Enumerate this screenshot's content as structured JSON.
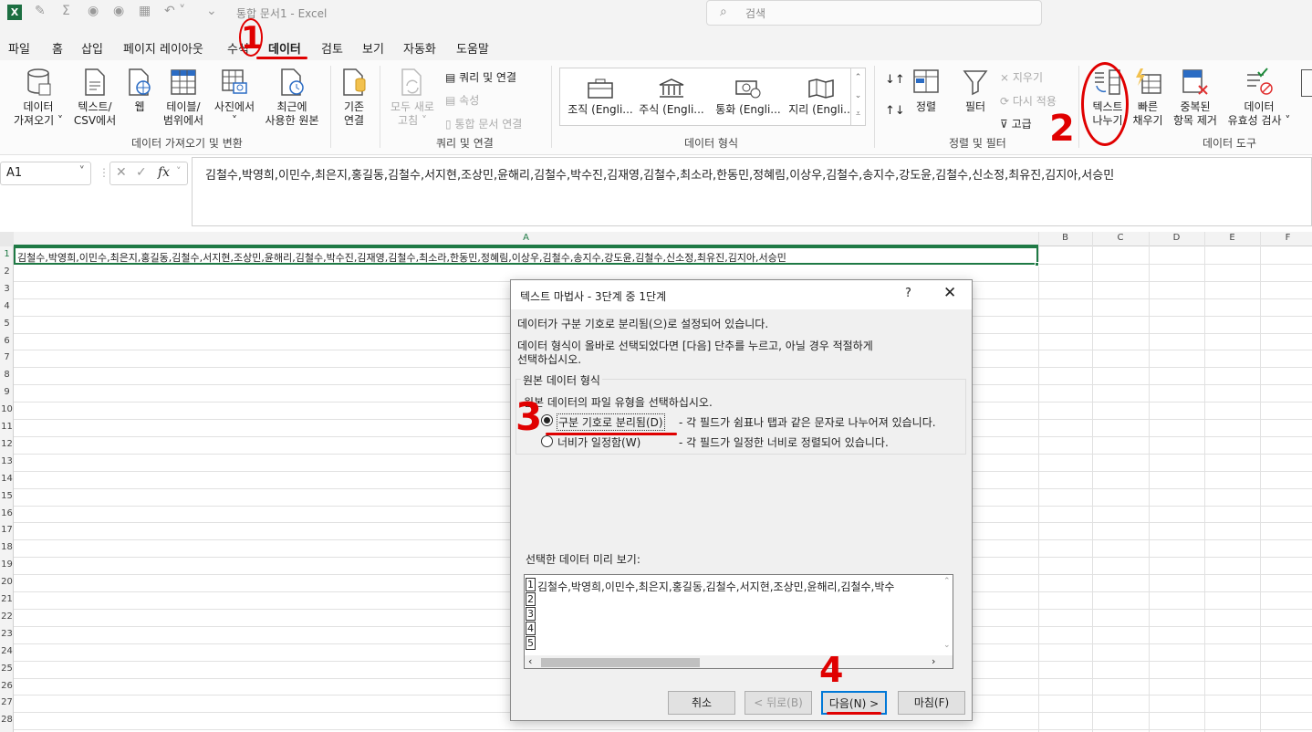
{
  "titlebar": {
    "doc_title": "통합 문서1  -  Excel",
    "search_placeholder": "검색"
  },
  "menu": {
    "tabs": [
      "파일",
      "홈",
      "삽입",
      "페이지 레이아웃",
      "수식",
      "데이터",
      "검토",
      "보기",
      "자동화",
      "도움말"
    ],
    "active": "데이터"
  },
  "ribbon": {
    "get_data": {
      "label1": "데이터",
      "label2": "가져오기 ˅"
    },
    "text_csv": {
      "label1": "텍스트/",
      "label2": "CSV에서"
    },
    "web": {
      "label1": "웹"
    },
    "table_range": {
      "label1": "테이블/",
      "label2": "범위에서"
    },
    "from_picture": {
      "label1": "사진에서",
      "label2": "˅"
    },
    "recent_sources": {
      "label1": "최근에",
      "label2": "사용한 원본"
    },
    "existing_conn": {
      "label1": "기존",
      "label2": "연결"
    },
    "group1": "데이터 가져오기 및 변환",
    "refresh_all": {
      "label1": "모두 새로",
      "label2": "고침 ˅"
    },
    "queries_conn": "쿼리 및 연결",
    "properties": "속성",
    "edit_links": "통합 문서 연결",
    "group2": "쿼리 및 연결",
    "data_types": [
      "조직 (Engli...",
      "주식 (Engli...",
      "통화 (Engli...",
      "지리 (Engli..."
    ],
    "group3": "데이터 형식",
    "sort": "정렬",
    "filter": "필터",
    "clear": "지우기",
    "reapply": "다시 적용",
    "advanced": "고급",
    "group4": "정렬 및 필터",
    "text_to_columns": {
      "label1": "텍스트",
      "label2": "나누기"
    },
    "flash_fill": {
      "label1": "빠른",
      "label2": "채우기"
    },
    "remove_dup": {
      "label1": "중복된",
      "label2": "항목 제거"
    },
    "validation": {
      "label1": "데이터",
      "label2": "유효성 검사 ˅"
    },
    "group5": "데이터 도구"
  },
  "formula_bar": {
    "name_box": "A1",
    "fx": "fx",
    "value": "김철수,박영희,이민수,최은지,홍길동,김철수,서지현,조상민,윤해리,김철수,박수진,김재영,김철수,최소라,한동민,정혜림,이상우,김철수,송지수,강도윤,김철수,신소정,최유진,김지아,서승민"
  },
  "grid": {
    "columns": [
      "A",
      "B",
      "C",
      "D",
      "E",
      "F"
    ],
    "rows": [
      "1",
      "2",
      "3",
      "4",
      "5",
      "6",
      "7",
      "8",
      "9",
      "10",
      "11",
      "12",
      "13",
      "14",
      "15",
      "16",
      "17",
      "18",
      "19",
      "20",
      "21",
      "22",
      "23",
      "24",
      "25",
      "26",
      "27",
      "28"
    ],
    "a1": "김철수,박영희,이민수,최은지,홍길동,김철수,서지현,조상민,윤해리,김철수,박수진,김재영,김철수,최소라,한동민,정혜림,이상우,김철수,송지수,강도윤,김철수,신소정,최유진,김지아,서승민"
  },
  "dialog": {
    "title": "텍스트 마법사 - 3단계 중 1단계",
    "help": "?",
    "close": "✕",
    "line1": "데이터가 구분 기호로 분리됨(으)로 설정되어 있습니다.",
    "line2": "데이터 형식이 올바로 선택되었다면 [다음] 단추를 누르고, 아닐 경우 적절하게",
    "line3": "선택하십시오.",
    "group_title": "원본 데이터 형식",
    "group_prompt": "원본 데이터의 파일 유형을 선택하십시오.",
    "opt1_label": "구분 기호로 분리됨(D)",
    "opt1_desc": "- 각 필드가 쉼표나 탭과 같은 문자로 나누어져 있습니다.",
    "opt2_label": "너비가 일정함(W)",
    "opt2_desc": "- 각 필드가 일정한 너비로 정렬되어 있습니다.",
    "preview_label": "선택한 데이터 미리 보기:",
    "preview_rows": [
      "1",
      "2",
      "3",
      "4",
      "5"
    ],
    "preview_text": "김철수,박영희,이민수,최은지,홍길동,김철수,서지현,조상민,윤해리,김철수,박수",
    "buttons": {
      "cancel": "취소",
      "back": "< 뒤로(B)",
      "next": "다음(N) >",
      "finish": "마침(F)"
    }
  },
  "annotations": {
    "n1": "1",
    "n2": "2",
    "n3": "3",
    "n4": "4"
  }
}
